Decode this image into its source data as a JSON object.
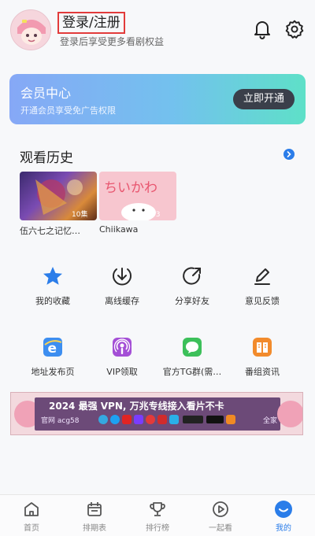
{
  "header": {
    "login_title": "登录/注册",
    "login_sub": "登录后享受更多看剧权益",
    "icons": [
      "bell-icon",
      "gear-icon"
    ]
  },
  "vip": {
    "title": "会员中心",
    "subtitle": "开通会员享受免广告权限",
    "button": "立即开通"
  },
  "history": {
    "title": "观看历史",
    "items": [
      {
        "label": "伍六七之记忆…",
        "badge": "10集"
      },
      {
        "label": "Chiikawa",
        "badge": "03"
      }
    ],
    "thumb2_logo": "ちいかわ"
  },
  "grid": [
    {
      "label": "我的收藏",
      "icon": "star-icon"
    },
    {
      "label": "离线缓存",
      "icon": "download-icon"
    },
    {
      "label": "分享好友",
      "icon": "share-icon"
    },
    {
      "label": "意见反馈",
      "icon": "edit-icon"
    },
    {
      "label": "地址发布页",
      "icon": "browser-icon"
    },
    {
      "label": "VIP领取",
      "icon": "podcast-icon"
    },
    {
      "label": "官方TG群(需…",
      "icon": "chat-icon"
    },
    {
      "label": "番组资讯",
      "icon": "book-icon"
    }
  ],
  "banner": {
    "text": "2024 最强 VPN, 万兆专线接入看片不卡",
    "sub": "官网 acg58",
    "right": "全家"
  },
  "tabs": [
    {
      "label": "首页",
      "icon": "home-icon"
    },
    {
      "label": "排期表",
      "icon": "calendar-icon"
    },
    {
      "label": "排行榜",
      "icon": "trophy-icon"
    },
    {
      "label": "一起看",
      "icon": "play-icon"
    },
    {
      "label": "我的",
      "icon": "profile-icon"
    }
  ],
  "colors": {
    "accent": "#2b7de9",
    "highlight_box": "#e23b3b",
    "vip_button": "#3a3f4a"
  }
}
